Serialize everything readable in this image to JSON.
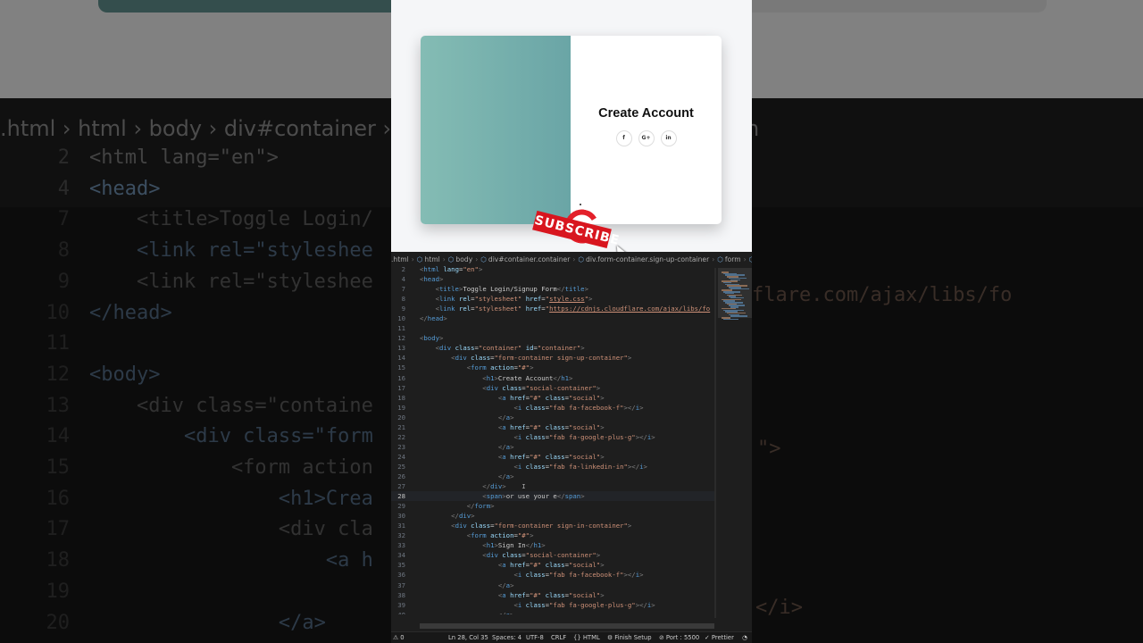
{
  "background": {
    "breadcrumb": [
      ".html",
      "html",
      "body",
      "div#container",
      "er.sign-up-container",
      "form",
      "span"
    ],
    "lines": [
      {
        "n": "2",
        "code": "<html lang=\"en\">"
      },
      {
        "n": "4",
        "code": "<head>"
      },
      {
        "n": "7",
        "code": "    <title>Toggle Login/"
      },
      {
        "n": "8",
        "code": "    <link rel=\"styleshee"
      },
      {
        "n": "9",
        "code": "    <link rel=\"styleshee"
      },
      {
        "n": "10",
        "code": "</head>"
      },
      {
        "n": "11",
        "code": ""
      },
      {
        "n": "12",
        "code": "<body>"
      },
      {
        "n": "13",
        "code": "    <div class=\"containe"
      },
      {
        "n": "14",
        "code": "        <div class=\"form"
      },
      {
        "n": "15",
        "code": "            <form action"
      },
      {
        "n": "16",
        "code": "                <h1>Crea"
      },
      {
        "n": "17",
        "code": "                <div cla"
      },
      {
        "n": "18",
        "code": "                    <a h"
      },
      {
        "n": "19",
        "code": "                    "
      },
      {
        "n": "20",
        "code": "                </a>"
      }
    ],
    "right_fragments": [
      "flare.com/ajax/libs/fo",
      "\">",
      "</i>"
    ]
  },
  "preview": {
    "form_title": "Create Account",
    "social_icons": [
      {
        "icon": "facebook-icon",
        "glyph": "f"
      },
      {
        "icon": "google-plus-icon",
        "glyph": "G+"
      },
      {
        "icon": "linkedin-icon",
        "glyph": "in"
      }
    ],
    "sticker_text": "SUBSCRIBE",
    "colors": {
      "overlay_start": "#84bcb4",
      "overlay_end": "#6aa5a6",
      "sticker": "#d8161f"
    }
  },
  "editor": {
    "breadcrumb": [
      ".html",
      "html",
      "body",
      "div#container.container",
      "div.form-container.sign-up-container",
      "form",
      "span"
    ],
    "code_lines": [
      {
        "n": "2",
        "html": "<span class=\"g\">&lt;</span><span class=\"t\">html</span> <span class=\"a\">lang</span>=<span class=\"s\">\"en\"</span><span class=\"g\">&gt;</span>"
      },
      {
        "n": "4",
        "html": "<span class=\"g\">&lt;</span><span class=\"t\">head</span><span class=\"g\">&gt;</span>"
      },
      {
        "n": "7",
        "html": "    <span class=\"g\">&lt;</span><span class=\"t\">title</span><span class=\"g\">&gt;</span>Toggle Login/Signup Form<span class=\"g\">&lt;/</span><span class=\"t\">title</span><span class=\"g\">&gt;</span>"
      },
      {
        "n": "8",
        "html": "    <span class=\"g\">&lt;</span><span class=\"t\">link</span> <span class=\"a\">rel</span>=<span class=\"s\">\"stylesheet\"</span> <span class=\"a\">href</span>=<span class=\"s\">\"<u>style.css</u>\"</span><span class=\"g\">&gt;</span>"
      },
      {
        "n": "9",
        "html": "    <span class=\"g\">&lt;</span><span class=\"t\">link</span> <span class=\"a\">rel</span>=<span class=\"s\">\"stylesheet\"</span> <span class=\"a\">href</span>=<span class=\"s\">\"</span><span class=\"u\">https://cdnjs.cloudflare.com/ajax/libs/fo</span>"
      },
      {
        "n": "10",
        "html": "<span class=\"g\">&lt;/</span><span class=\"t\">head</span><span class=\"g\">&gt;</span>"
      },
      {
        "n": "11",
        "html": ""
      },
      {
        "n": "12",
        "html": "<span class=\"g\">&lt;</span><span class=\"t\">body</span><span class=\"g\">&gt;</span>"
      },
      {
        "n": "13",
        "html": "    <span class=\"g\">&lt;</span><span class=\"t\">div</span> <span class=\"a\">class</span>=<span class=\"s\">\"container\"</span> <span class=\"a\">id</span>=<span class=\"s\">\"container\"</span><span class=\"g\">&gt;</span>"
      },
      {
        "n": "14",
        "html": "        <span class=\"g\">&lt;</span><span class=\"t\">div</span> <span class=\"a\">class</span>=<span class=\"s\">\"form-container sign-up-container\"</span><span class=\"g\">&gt;</span>"
      },
      {
        "n": "15",
        "html": "            <span class=\"g\">&lt;</span><span class=\"t\">form</span> <span class=\"a\">action</span>=<span class=\"s\">\"#\"</span><span class=\"g\">&gt;</span>"
      },
      {
        "n": "16",
        "html": "                <span class=\"g\">&lt;</span><span class=\"t\">h1</span><span class=\"g\">&gt;</span>Create Account<span class=\"g\">&lt;/</span><span class=\"t\">h1</span><span class=\"g\">&gt;</span>"
      },
      {
        "n": "17",
        "html": "                <span class=\"g\">&lt;</span><span class=\"t\">div</span> <span class=\"a\">class</span>=<span class=\"s\">\"social-container\"</span><span class=\"g\">&gt;</span>"
      },
      {
        "n": "18",
        "html": "                    <span class=\"g\">&lt;</span><span class=\"t\">a</span> <span class=\"a\">href</span>=<span class=\"s\">\"#\"</span> <span class=\"a\">class</span>=<span class=\"s\">\"social\"</span><span class=\"g\">&gt;</span>"
      },
      {
        "n": "19",
        "html": "                        <span class=\"g\">&lt;</span><span class=\"t\">i</span> <span class=\"a\">class</span>=<span class=\"s\">\"fab fa-facebook-f\"</span><span class=\"g\">&gt;&lt;/</span><span class=\"t\">i</span><span class=\"g\">&gt;</span>"
      },
      {
        "n": "20",
        "html": "                    <span class=\"g\">&lt;/</span><span class=\"t\">a</span><span class=\"g\">&gt;</span>"
      },
      {
        "n": "21",
        "html": "                    <span class=\"g\">&lt;</span><span class=\"t\">a</span> <span class=\"a\">href</span>=<span class=\"s\">\"#\"</span> <span class=\"a\">class</span>=<span class=\"s\">\"social\"</span><span class=\"g\">&gt;</span>"
      },
      {
        "n": "22",
        "html": "                        <span class=\"g\">&lt;</span><span class=\"t\">i</span> <span class=\"a\">class</span>=<span class=\"s\">\"fab fa-google-plus-g\"</span><span class=\"g\">&gt;&lt;/</span><span class=\"t\">i</span><span class=\"g\">&gt;</span>"
      },
      {
        "n": "23",
        "html": "                    <span class=\"g\">&lt;/</span><span class=\"t\">a</span><span class=\"g\">&gt;</span>"
      },
      {
        "n": "24",
        "html": "                    <span class=\"g\">&lt;</span><span class=\"t\">a</span> <span class=\"a\">href</span>=<span class=\"s\">\"#\"</span> <span class=\"a\">class</span>=<span class=\"s\">\"social\"</span><span class=\"g\">&gt;</span>"
      },
      {
        "n": "25",
        "html": "                        <span class=\"g\">&lt;</span><span class=\"t\">i</span> <span class=\"a\">class</span>=<span class=\"s\">\"fab fa-linkedin-in\"</span><span class=\"g\">&gt;&lt;/</span><span class=\"t\">i</span><span class=\"g\">&gt;</span>"
      },
      {
        "n": "26",
        "html": "                    <span class=\"g\">&lt;/</span><span class=\"t\">a</span><span class=\"g\">&gt;</span>"
      },
      {
        "n": "27",
        "html": "                <span class=\"g\">&lt;/</span><span class=\"t\">div</span><span class=\"g\">&gt;</span>    <span style=\"color:#aaa\">I</span>"
      },
      {
        "n": "28",
        "html": "                <span class=\"g\">&lt;</span><span class=\"t\">span</span><span class=\"g\">&gt;</span>or use your e<span class=\"g\">&lt;/</span><span class=\"t\">span</span><span class=\"g\">&gt;</span>",
        "active": true
      },
      {
        "n": "29",
        "html": "            <span class=\"g\">&lt;/</span><span class=\"t\">form</span><span class=\"g\">&gt;</span>"
      },
      {
        "n": "30",
        "html": "        <span class=\"g\">&lt;/</span><span class=\"t\">div</span><span class=\"g\">&gt;</span>"
      },
      {
        "n": "31",
        "html": "        <span class=\"g\">&lt;</span><span class=\"t\">div</span> <span class=\"a\">class</span>=<span class=\"s\">\"form-container sign-in-container\"</span><span class=\"g\">&gt;</span>"
      },
      {
        "n": "32",
        "html": "            <span class=\"g\">&lt;</span><span class=\"t\">form</span> <span class=\"a\">action</span>=<span class=\"s\">\"#\"</span><span class=\"g\">&gt;</span>"
      },
      {
        "n": "33",
        "html": "                <span class=\"g\">&lt;</span><span class=\"t\">h1</span><span class=\"g\">&gt;</span>Sign In<span class=\"g\">&lt;/</span><span class=\"t\">h1</span><span class=\"g\">&gt;</span>"
      },
      {
        "n": "34",
        "html": "                <span class=\"g\">&lt;</span><span class=\"t\">div</span> <span class=\"a\">class</span>=<span class=\"s\">\"social-container\"</span><span class=\"g\">&gt;</span>"
      },
      {
        "n": "35",
        "html": "                    <span class=\"g\">&lt;</span><span class=\"t\">a</span> <span class=\"a\">href</span>=<span class=\"s\">\"#\"</span> <span class=\"a\">class</span>=<span class=\"s\">\"social\"</span><span class=\"g\">&gt;</span>"
      },
      {
        "n": "36",
        "html": "                        <span class=\"g\">&lt;</span><span class=\"t\">i</span> <span class=\"a\">class</span>=<span class=\"s\">\"fab fa-facebook-f\"</span><span class=\"g\">&gt;&lt;/</span><span class=\"t\">i</span><span class=\"g\">&gt;</span>"
      },
      {
        "n": "37",
        "html": "                    <span class=\"g\">&lt;/</span><span class=\"t\">a</span><span class=\"g\">&gt;</span>"
      },
      {
        "n": "38",
        "html": "                    <span class=\"g\">&lt;</span><span class=\"t\">a</span> <span class=\"a\">href</span>=<span class=\"s\">\"#\"</span> <span class=\"a\">class</span>=<span class=\"s\">\"social\"</span><span class=\"g\">&gt;</span>"
      },
      {
        "n": "39",
        "html": "                        <span class=\"g\">&lt;</span><span class=\"t\">i</span> <span class=\"a\">class</span>=<span class=\"s\">\"fab fa-google-plus-g\"</span><span class=\"g\">&gt;&lt;/</span><span class=\"t\">i</span><span class=\"g\">&gt;</span>"
      },
      {
        "n": "40",
        "html": "                    <span class=\"g\">&lt;/</span><span class=\"t\">a</span><span class=\"g\">&gt;</span>"
      },
      {
        "n": "41",
        "html": "                    <span class=\"g\">&lt;</span><span class=\"t\">a</span> <span class=\"a\">href</span>=<span class=\"s\">\"#\"</span> <span class=\"a\">class</span>=<span class=\"s\">\"social\"</span><span class=\"g\">&gt;</span>"
      }
    ],
    "status": {
      "problems": "0",
      "position": "Ln 28, Col 35",
      "spaces": "Spaces: 4",
      "encoding": "UTF-8",
      "eol": "CRLF",
      "language": "HTML",
      "finish_setup": "Finish Setup",
      "port": "Port : 5500",
      "prettier": "Prettier"
    }
  }
}
